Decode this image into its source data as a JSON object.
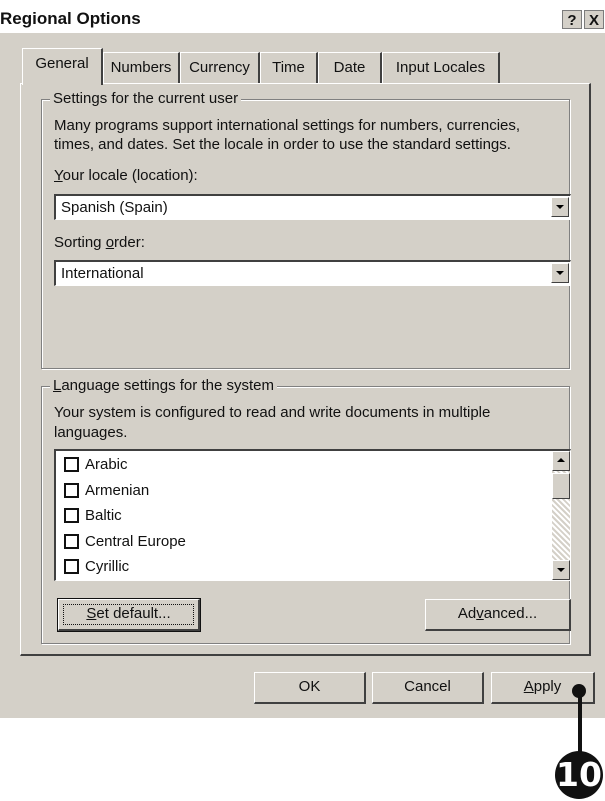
{
  "window": {
    "title": "Regional Options",
    "help_label": "?",
    "close_label": "X"
  },
  "tabs": [
    {
      "label": "General",
      "active": true
    },
    {
      "label": "Numbers",
      "active": false
    },
    {
      "label": "Currency",
      "active": false
    },
    {
      "label": "Time",
      "active": false
    },
    {
      "label": "Date",
      "active": false
    },
    {
      "label": "Input Locales",
      "active": false
    }
  ],
  "user_settings": {
    "legend": "Settings for the current user",
    "description_line1": "Many programs support international settings for numbers, currencies,",
    "description_line2": "times, and dates. Set the locale in order to use the standard settings.",
    "locale": {
      "label_accel": "Y",
      "label_rest": "our locale (location):",
      "value": "Spanish (Spain)"
    },
    "sorting": {
      "label_pre": "Sorting ",
      "label_accel": "o",
      "label_rest": "rder:",
      "value": "International"
    }
  },
  "system_settings": {
    "legend_accel": "L",
    "legend_rest": "anguage settings for the system",
    "description_line1": "Your system is configured to read and write documents in multiple",
    "description_line2": "languages.",
    "languages": [
      {
        "label": "Arabic",
        "checked": false
      },
      {
        "label": "Armenian",
        "checked": false
      },
      {
        "label": "Baltic",
        "checked": false
      },
      {
        "label": "Central Europe",
        "checked": false
      },
      {
        "label": "Cyrillic",
        "checked": false
      }
    ],
    "set_default": {
      "accel": "S",
      "rest": "et default..."
    },
    "advanced": {
      "pre": "Ad",
      "accel": "v",
      "rest": "anced..."
    }
  },
  "footer": {
    "ok_label": "OK",
    "cancel_label": "Cancel",
    "apply": {
      "accel": "A",
      "rest": "pply"
    }
  },
  "callout": {
    "number": "10"
  }
}
